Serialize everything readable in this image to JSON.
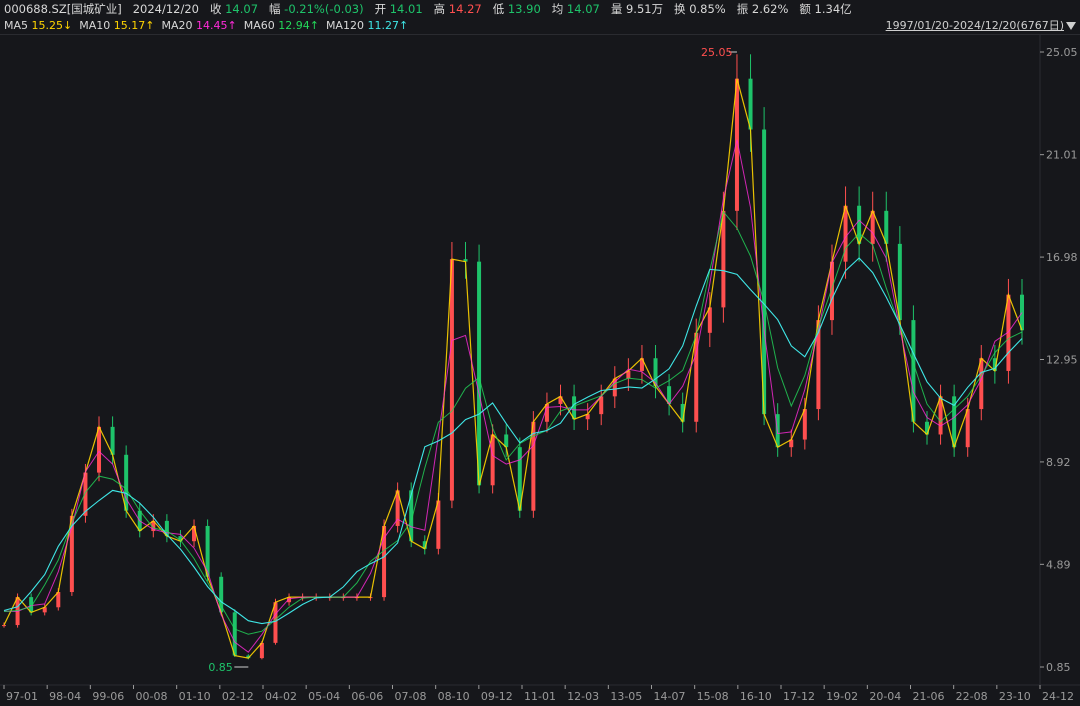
{
  "header": {
    "code": "000688.SZ[国城矿业]",
    "date": "2024/12/20",
    "close_label": "收",
    "close": "14.07",
    "chg_label": "幅",
    "chg": "-0.21%(-0.03)",
    "open_label": "开",
    "open": "14.01",
    "high_label": "高",
    "high": "14.27",
    "low_label": "低",
    "low": "13.90",
    "avg_label": "均",
    "avg": "14.07",
    "vol_label": "量",
    "vol": "9.51万",
    "turn_label": "换",
    "turn": "0.85%",
    "amp_label": "振",
    "amp": "2.62%",
    "amt_label": "额",
    "amt": "1.34亿"
  },
  "ma_bar": {
    "ma5_label": "MA5",
    "ma5": "15.25↓",
    "ma10_label": "MA10",
    "ma10": "15.17↑",
    "ma20_label": "MA20",
    "ma20": "14.45↑",
    "ma60_label": "MA60",
    "ma60": "12.94↑",
    "ma120_label": "MA120",
    "ma120": "11.27↑"
  },
  "range": {
    "text": "1997/01/20-2024/12/20(6767日)"
  },
  "colors": {
    "bg": "#16171b",
    "up": "#ff4f4f",
    "down": "#1ec36a",
    "grid": "#2a2b30",
    "axis": "#9a9a9a",
    "ma5": "#ffffff",
    "ma10": "#ffd400",
    "ma20": "#ff2bd9",
    "ma60": "#23d85a",
    "ma120": "#3fe6e6"
  },
  "chart_data": {
    "type": "line",
    "title": "",
    "xlabel": "",
    "ylabel": "",
    "ylim": [
      0.85,
      25.05
    ],
    "yticks": [
      "25.05",
      "21.01",
      "16.98",
      "12.95",
      "8.92",
      "4.89",
      "0.85"
    ],
    "xticks": [
      "97-01",
      "98-04",
      "99-06",
      "00-08",
      "01-10",
      "02-12",
      "04-02",
      "05-04",
      "06-06",
      "07-08",
      "08-10",
      "09-12",
      "11-01",
      "12-03",
      "13-05",
      "14-07",
      "15-08",
      "16-10",
      "17-12",
      "19-02",
      "20-04",
      "21-06",
      "22-08",
      "23-10",
      "24-12"
    ],
    "max_label": "25.05",
    "min_label": "0.85",
    "x": [
      "97-01",
      "97-07",
      "98-01",
      "98-07",
      "99-01",
      "99-07",
      "00-01",
      "00-07",
      "01-01",
      "01-07",
      "02-01",
      "02-07",
      "03-01",
      "03-07",
      "04-01",
      "04-07",
      "05-01",
      "05-07",
      "06-01",
      "06-07",
      "06-10",
      "07-01",
      "08-01",
      "09-01",
      "10-01",
      "11-01",
      "12-01",
      "12-12",
      "13-01",
      "13-03",
      "13-06",
      "13-09",
      "14-01",
      "14-06",
      "14-10",
      "15-02",
      "15-05",
      "15-07",
      "15-10",
      "16-01",
      "16-04",
      "16-07",
      "16-10",
      "17-01",
      "17-06",
      "17-10",
      "18-01",
      "18-04",
      "18-07",
      "19-01",
      "19-04",
      "19-07",
      "19-10",
      "20-01",
      "20-03",
      "20-04",
      "20-05",
      "20-07",
      "20-10",
      "21-01",
      "21-04",
      "21-07",
      "21-10",
      "22-01",
      "22-04",
      "22-07",
      "22-10",
      "23-01",
      "23-04",
      "23-07",
      "23-10",
      "24-01",
      "24-03",
      "24-06",
      "24-09",
      "24-12"
    ],
    "series": [
      {
        "values": [
          2.5,
          3.6,
          3.0,
          3.2,
          3.8,
          6.8,
          8.5,
          10.3,
          9.2,
          7.0,
          6.2,
          6.6,
          6.0,
          5.8,
          6.4,
          4.4,
          3.0,
          1.3,
          1.2,
          1.8,
          3.4,
          3.6,
          3.6,
          3.6,
          3.6,
          3.6,
          3.6,
          3.6,
          6.4,
          7.8,
          5.8,
          5.5,
          7.4,
          16.9,
          16.8,
          8.0,
          10.0,
          9.5,
          7.0,
          10.5,
          11.2,
          11.5,
          10.6,
          10.8,
          11.5,
          12.2,
          12.5,
          13.0,
          11.9,
          11.2,
          10.5,
          14.0,
          15.0,
          18.8,
          24.0,
          22.0,
          10.8,
          9.5,
          9.8,
          11.0,
          14.5,
          16.8,
          19.0,
          17.5,
          18.8,
          17.5,
          14.5,
          10.5,
          10.0,
          11.5,
          9.5,
          11.0,
          13.0,
          12.5,
          15.5,
          14.1
        ]
      }
    ]
  }
}
